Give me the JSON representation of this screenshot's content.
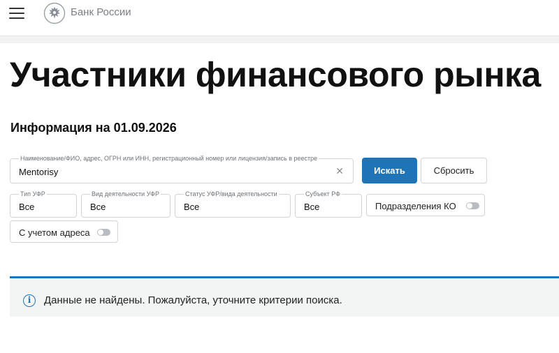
{
  "header": {
    "menu_icon": "hamburger-icon",
    "logo_icon": "bank-eagle-emblem-icon",
    "brand": "Банк России"
  },
  "page": {
    "title": "Участники финансового рынка",
    "info_date": "Информация на 01.09.2026"
  },
  "search": {
    "label": "Наименование/ФИО, адрес, ОГРН или ИНН, регистрационный номер или лицензия/запись в реестре",
    "value": "Mentorisy",
    "clear_icon": "close-icon",
    "search_button": "Искать",
    "reset_button": "Сбросить"
  },
  "filters": {
    "type": {
      "label": "Тип УФР",
      "value": "Все"
    },
    "activity": {
      "label": "Вид деятельности УФР",
      "value": "Все"
    },
    "status": {
      "label": "Статус УФР/вида деятельности",
      "value": "Все"
    },
    "subject": {
      "label": "Субъект РФ",
      "value": "Все"
    },
    "ko_divisions": {
      "label": "Подразделения КО",
      "enabled": false
    },
    "with_address": {
      "label": "С учетом адреса",
      "enabled": false
    }
  },
  "alert": {
    "icon": "info-icon",
    "text": "Данные не найдены. Пожалуйста, уточните критерии поиска."
  },
  "colors": {
    "accent": "#1f74b8",
    "alert_background": "#f3f4f4",
    "border": "#d1d3d6"
  }
}
